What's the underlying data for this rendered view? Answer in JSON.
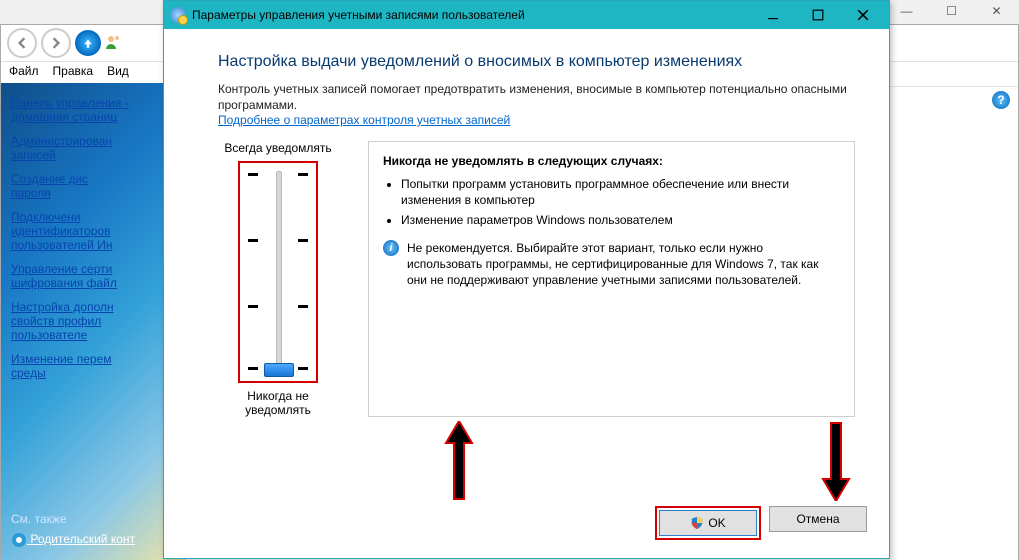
{
  "outer": {
    "min": "—",
    "max": "☐",
    "close": "✕"
  },
  "bg": {
    "menus": {
      "file": "Файл",
      "edit": "Правка",
      "view": "Вид"
    },
    "side_home1": "Панель управления -",
    "side_home2": "домашняя страниц",
    "links": {
      "l1": "Администрирован",
      "l1b": "записей",
      "l2": "Создание дис",
      "l2b": "пароля",
      "l3": "Подключени",
      "l3b": "идентификаторов",
      "l3c": "пользователей Ин",
      "l4": "Управление серти",
      "l4b": "шифрования файл",
      "l5": "Настройка дополн",
      "l5b": "свойств профил",
      "l5c": "пользователе",
      "l6": "Изменение перем",
      "l6b": "среды"
    },
    "foot_hdr": "См. также",
    "foot_link": "Родительский конт"
  },
  "dlg": {
    "title": "Параметры управления учетными записями пользователей",
    "h1": "Настройка выдачи уведомлений о вносимых в компьютер изменениях",
    "para": "Контроль учетных записей помогает предотвратить изменения, вносимые в компьютер потенциально опасными программами.",
    "link": "Подробнее о параметрах контроля учетных записей",
    "slider_top": "Всегда уведомлять",
    "slider_bottom": "Никогда не уведомлять",
    "desc_hdr": "Никогда не уведомлять в следующих случаях:",
    "bullet1": "Попытки программ установить программное обеспечение или внести изменения в компьютер",
    "bullet2": "Изменение параметров Windows пользователем",
    "note": "Не рекомендуется. Выбирайте этот вариант, только если нужно использовать программы, не сертифицированные для Windows 7, так как они не поддерживают управление учетными записями пользователей.",
    "ok": "OK",
    "cancel": "Отмена"
  }
}
